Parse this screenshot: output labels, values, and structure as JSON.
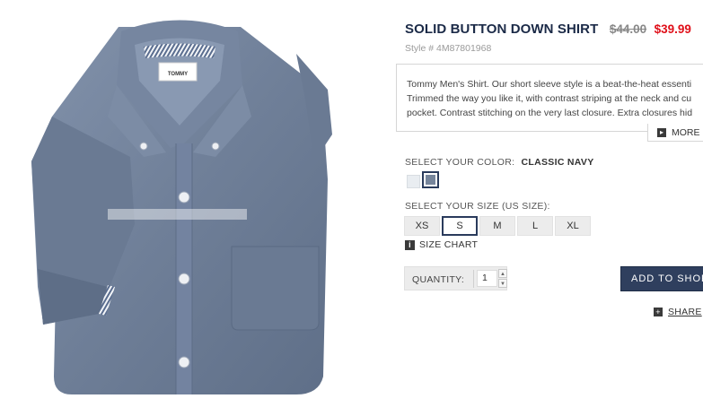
{
  "product": {
    "title": "SOLID BUTTON DOWN SHIRT",
    "old_price": "$44.00",
    "new_price": "$39.99",
    "style": "Style # 4M87801968",
    "label_text": "TOMMY",
    "description": [
      "Tommy Men's Shirt. Our short sleeve style is a beat-the-heat essenti",
      "Trimmed the way you like it, with contrast striping at the neck and cu",
      "pocket. Contrast stitching on the very last closure. Extra closures hid"
    ],
    "more_label": "MORE"
  },
  "color": {
    "label": "SELECT YOUR COLOR:",
    "selected": "CLASSIC NAVY",
    "swatches": [
      {
        "name": "white",
        "hex": "#e9edf1"
      },
      {
        "name": "classic navy",
        "hex": "#76859b"
      }
    ]
  },
  "size": {
    "label": "SELECT YOUR SIZE (US SIZE):",
    "options": [
      "XS",
      "S",
      "M",
      "L",
      "XL"
    ],
    "selected": "S",
    "chart_label": "SIZE CHART"
  },
  "quantity": {
    "label": "QUANTITY:",
    "value": "1"
  },
  "actions": {
    "add_label": "ADD TO SHOP",
    "share_label": "SHARE"
  },
  "colors": {
    "title": "#1b2a47",
    "sale": "#e0101a",
    "button": "#2f3f5e",
    "shirt": "#6f7f98"
  }
}
